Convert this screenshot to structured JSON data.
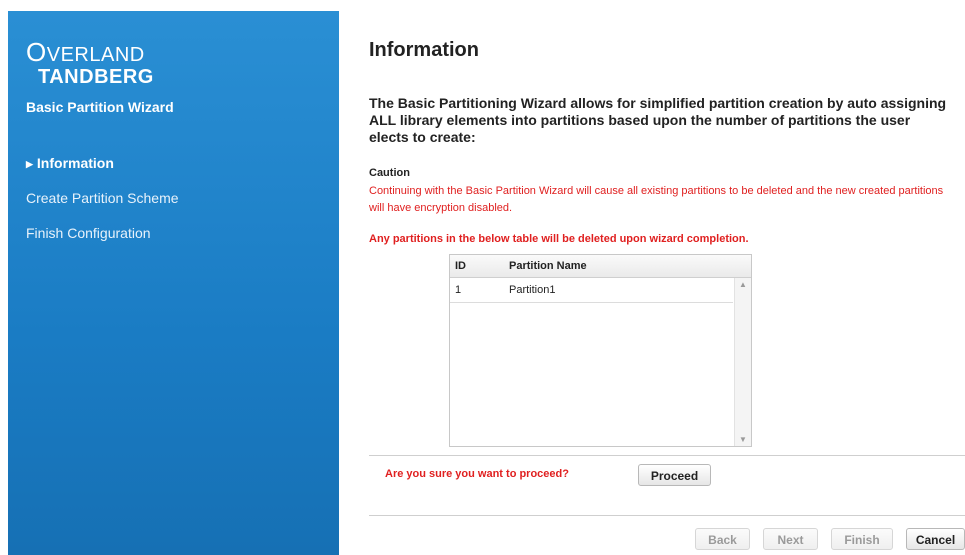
{
  "brand": {
    "line1_initial": "O",
    "line1_rest": "VERLAND",
    "line2": "TANDBERG"
  },
  "sidebar": {
    "title": "Basic Partition Wizard",
    "items": [
      {
        "label": "Information",
        "active": true
      },
      {
        "label": "Create Partition Scheme",
        "active": false
      },
      {
        "label": "Finish Configuration",
        "active": false
      }
    ]
  },
  "main": {
    "title": "Information",
    "intro": "The Basic Partitioning Wizard allows for simplified partition creation by auto assigning ALL library elements into partitions based upon the number of partitions the user elects to create:",
    "caution_heading": "Caution",
    "caution_text": "Continuing with the Basic Partition Wizard will cause all existing partitions to be deleted and the new created partitions will have encryption disabled.",
    "warning": "Any partitions in the below table will be deleted upon wizard completion.",
    "table": {
      "columns": [
        "ID",
        "Partition Name"
      ],
      "rows": [
        {
          "id": "1",
          "name": "Partition1"
        }
      ]
    },
    "proceed_question": "Are you sure you want to proceed?",
    "proceed_label": "Proceed"
  },
  "footer": {
    "back_label": "Back",
    "next_label": "Next",
    "finish_label": "Finish",
    "cancel_label": "Cancel"
  },
  "colors": {
    "sidebar_bg": "#1f84cc",
    "warning_red": "#e02020"
  }
}
